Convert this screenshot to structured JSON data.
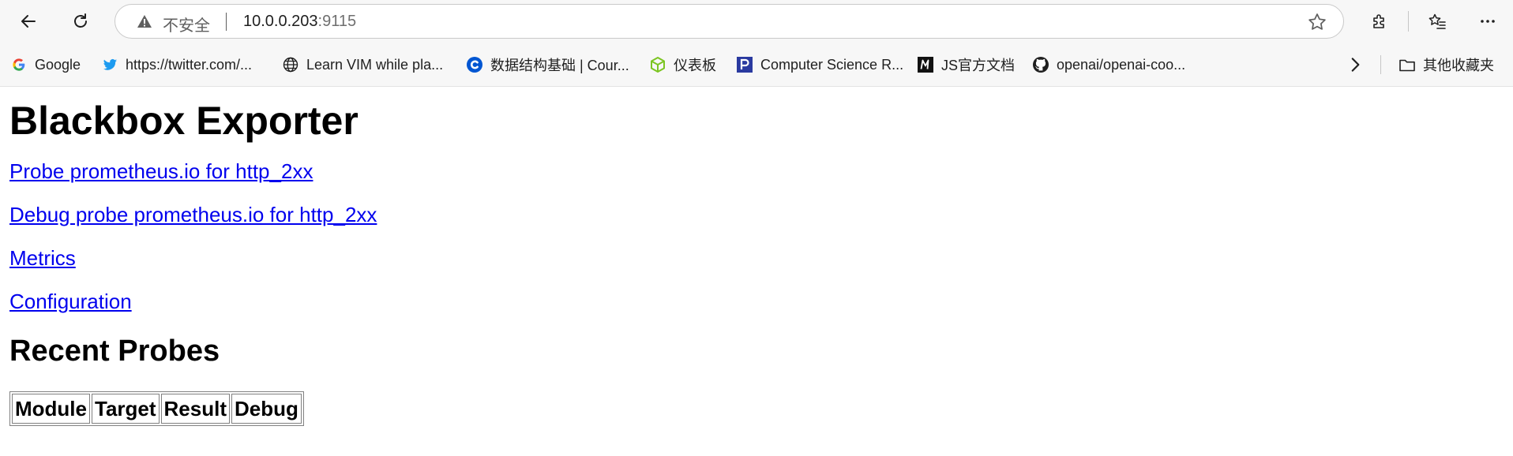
{
  "browser": {
    "address": {
      "security_label": "不安全",
      "host": "10.0.0.203",
      "port": ":9115"
    },
    "bookmarks": [
      {
        "label": "Google",
        "icon": "google-icon"
      },
      {
        "label": "https://twitter.com/...",
        "icon": "twitter-icon"
      },
      {
        "label": "Learn VIM while pla...",
        "icon": "globe-icon"
      },
      {
        "label": "数据结构基础 | Cour...",
        "icon": "coursera-icon"
      },
      {
        "label": "仪表板",
        "icon": "dashboard-icon"
      },
      {
        "label": "Computer Science R...",
        "icon": "p-icon"
      },
      {
        "label": "JS官方文档",
        "icon": "m-icon"
      },
      {
        "label": "openai/openai-coo...",
        "icon": "github-icon"
      }
    ],
    "other_bookmarks_label": "其他收藏夹"
  },
  "page": {
    "title": "Blackbox Exporter",
    "links": [
      "Probe prometheus.io for http_2xx",
      "Debug probe prometheus.io for http_2xx",
      "Metrics",
      "Configuration"
    ],
    "recent_title": "Recent Probes",
    "table_headers": [
      "Module",
      "Target",
      "Result",
      "Debug"
    ]
  },
  "colors": {
    "link": "#0000ee",
    "toolbar_bg": "#f7f7f7"
  }
}
